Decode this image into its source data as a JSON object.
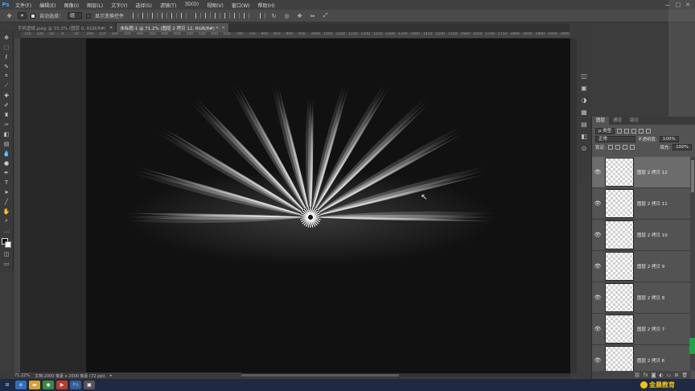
{
  "app": {
    "logo": "Ps",
    "menu": [
      "文件(F)",
      "编辑(E)",
      "图像(I)",
      "图层(L)",
      "文字(Y)",
      "选择(S)",
      "滤镜(T)",
      "3D(D)",
      "视图(V)",
      "窗口(W)",
      "帮助(H)"
    ],
    "window_controls": [
      "—",
      "□",
      "✕"
    ]
  },
  "options": {
    "auto_select_label": "自动选择：",
    "auto_select_value": "组",
    "show_transform_label": "显示变换控件"
  },
  "tabs": [
    {
      "label": "手机壁纸.jpeg @ 33.3% (图层 0, RGB/8#)",
      "active": false
    },
    {
      "label": "未标题-1 @ 71.2% (图层 2 拷贝 12, RGB/8#) *",
      "active": true
    }
  ],
  "ruler_ticks": [
    "150",
    "100",
    "50",
    "0",
    "50",
    "100",
    "150",
    "200",
    "250",
    "300",
    "350",
    "400",
    "450",
    "500",
    "550",
    "600",
    "650",
    "700",
    "750",
    "800",
    "850",
    "900",
    "950",
    "1000",
    "1050",
    "1100",
    "1150",
    "1200",
    "1250",
    "1300",
    "1350",
    "1400",
    "1450",
    "1500",
    "1550",
    "1600",
    "1650",
    "1700",
    "1750",
    "1800",
    "1850",
    "1900",
    "1950",
    "2000"
  ],
  "status": {
    "zoom": "71.22%",
    "doc_size": "文档:2000 像素 x 2000 像素 (72 ppi)"
  },
  "layers_panel": {
    "tabs": [
      "图层",
      "通道",
      "路径"
    ],
    "kind_label": "ρ 类型",
    "blend_mode": "正常",
    "opacity_label": "不透明度:",
    "opacity_value": "100%",
    "lock_label": "锁定:",
    "fill_label": "填充:",
    "fill_value": "100%",
    "layers": [
      {
        "name": "图层 2 拷贝 12",
        "selected": true
      },
      {
        "name": "图层 2 拷贝 11",
        "selected": false
      },
      {
        "name": "图层 2 拷贝 10",
        "selected": false
      },
      {
        "name": "图层 2 拷贝 9",
        "selected": false
      },
      {
        "name": "图层 2 拷贝 8",
        "selected": false
      },
      {
        "name": "图层 2 拷贝 7",
        "selected": false
      },
      {
        "name": "图层 2 拷贝 6",
        "selected": false
      }
    ]
  },
  "watermark": "金晨教育",
  "colors": {
    "canvas_bg": "#111111",
    "accent": "#31a8ff",
    "watermark": "#f2c500"
  },
  "artwork": {
    "rays": 13
  }
}
